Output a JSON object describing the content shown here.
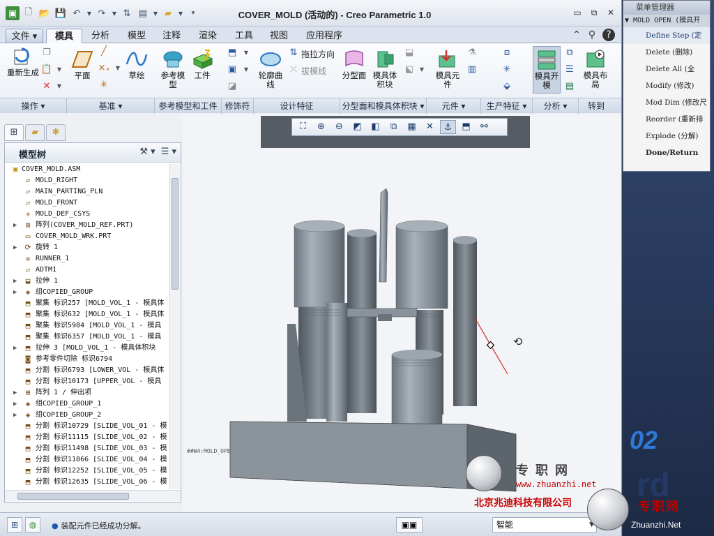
{
  "window": {
    "title": "COVER_MOLD (活动的) - Creo Parametric 1.0"
  },
  "quick_access": {
    "icons": [
      "app-icon",
      "new-icon",
      "open-icon",
      "save-icon",
      "undo-icon",
      "redo-icon",
      "regenerate-icon",
      "window-icon",
      "folder-icon",
      "customize-icon"
    ]
  },
  "tabs": [
    {
      "label": "文件"
    },
    {
      "label": "模具"
    },
    {
      "label": "分析"
    },
    {
      "label": "模型"
    },
    {
      "label": "注释"
    },
    {
      "label": "渲染"
    },
    {
      "label": "工具"
    },
    {
      "label": "视图"
    },
    {
      "label": "应用程序"
    }
  ],
  "ribbon": {
    "regenerate": "重新生成",
    "plane": "平面",
    "sketch": "草绘",
    "ref_model": "参考模型",
    "workpiece": "工件",
    "silhouette": "轮廓曲线",
    "drag_direction": "拖拉方向",
    "draft_line": "拔模线",
    "parting_surface": "分型面",
    "mold_volume": "模具体积块",
    "mold_component": "模具元件",
    "mold_open": "模具开模",
    "mold_layout": "模具布局",
    "groups": [
      "操作",
      "基准",
      "参考模型和工件",
      "修饰符",
      "设计特征",
      "分型面和模具体积块",
      "元件",
      "生产特征",
      "分析",
      "转到"
    ]
  },
  "model_tree": {
    "title": "模型树",
    "items": [
      {
        "label": "COVER_MOLD.ASM",
        "icon": "assembly-icon",
        "expand": ""
      },
      {
        "label": "MOLD_RIGHT",
        "icon": "datum-plane-icon",
        "expand": ""
      },
      {
        "label": "MAIN_PARTING_PLN",
        "icon": "datum-plane-icon",
        "expand": ""
      },
      {
        "label": "MOLD_FRONT",
        "icon": "datum-plane-icon",
        "expand": ""
      },
      {
        "label": "MOLD_DEF_CSYS",
        "icon": "csys-icon",
        "expand": ""
      },
      {
        "label": "阵列(COVER_MOLD_REF.PRT)",
        "icon": "pattern-icon",
        "expand": "▶"
      },
      {
        "label": "COVER_MOLD_WRK.PRT",
        "icon": "workpiece-icon",
        "expand": ""
      },
      {
        "label": "旋转 1",
        "icon": "revolve-icon",
        "expand": "▶"
      },
      {
        "label": "RUNNER_1",
        "icon": "runner-icon",
        "expand": ""
      },
      {
        "label": "ADTM1",
        "icon": "datum-plane-icon",
        "expand": ""
      },
      {
        "label": "拉伸 1",
        "icon": "extrude-icon",
        "expand": "▶"
      },
      {
        "label": "组COPIED_GROUP",
        "icon": "group-icon",
        "expand": "▶"
      },
      {
        "label": "聚集 标识257 [MOLD_VOL_1 - 模具体",
        "icon": "volume-icon",
        "expand": ""
      },
      {
        "label": "聚集 标识632 [MOLD_VOL_1 - 模具体",
        "icon": "volume-icon",
        "expand": ""
      },
      {
        "label": "聚集 标识5984 [MOLD_VOL_1 - 模具",
        "icon": "volume-icon",
        "expand": ""
      },
      {
        "label": "聚集 标识6357 [MOLD_VOL_1 - 模具",
        "icon": "volume-icon",
        "expand": ""
      },
      {
        "label": "拉伸 3 [MOLD_VOL_1 - 模具体积块",
        "icon": "volume-icon",
        "expand": "▶"
      },
      {
        "label": "参考零件切除 标识6794",
        "icon": "cutout-icon",
        "expand": ""
      },
      {
        "label": "分割 标识6793 [LOWER_VOL - 模具体",
        "icon": "volume-icon",
        "expand": ""
      },
      {
        "label": "分割 标识10173 [UPPER_VOL - 模具",
        "icon": "volume-icon",
        "expand": ""
      },
      {
        "label": "阵列 1 / 伸出项",
        "icon": "pattern-icon",
        "expand": "▶"
      },
      {
        "label": "组COPIED_GROUP_1",
        "icon": "group-icon",
        "expand": "▶"
      },
      {
        "label": "组COPIED_GROUP_2",
        "icon": "group-icon",
        "expand": "▶"
      },
      {
        "label": "分割 标识10729 [SLIDE_VOL_01 - 模",
        "icon": "volume-icon",
        "expand": ""
      },
      {
        "label": "分割 标识11115 [SLIDE_VOL_02 - 模",
        "icon": "volume-icon",
        "expand": ""
      },
      {
        "label": "分割 标识11498 [SLIDE_VOL_03 - 模",
        "icon": "volume-icon",
        "expand": ""
      },
      {
        "label": "分割 标识11866 [SLIDE_VOL_04 - 模",
        "icon": "volume-icon",
        "expand": ""
      },
      {
        "label": "分割 标识12252 [SLIDE_VOL_05 - 模",
        "icon": "volume-icon",
        "expand": ""
      },
      {
        "label": "分割 标识12635 [SLIDE_VOL_06 - 模",
        "icon": "volume-icon",
        "expand": ""
      }
    ]
  },
  "graphics": {
    "model_label": "MOLD_OPE"
  },
  "status": {
    "message": "装配元件已经成功分解。",
    "smart_filter": "智能"
  },
  "menu_manager": {
    "title": "菜单管理器",
    "subtitle": "▼ MOLD OPEN (模具开",
    "items": [
      {
        "label": "Define Step (定"
      },
      {
        "label": "Delete (删除)"
      },
      {
        "label": "Delete All (全"
      },
      {
        "label": "Modify (修改)"
      },
      {
        "label": "Mod Dim (修改尺"
      },
      {
        "label": "Reorder (重新排"
      },
      {
        "label": "Explode (分解)"
      },
      {
        "label": "Done/Return"
      }
    ]
  },
  "side_text": {
    "big": "02",
    "big2": "rd"
  },
  "watermarks": {
    "brand": "专职网",
    "url": "www.zhuanzhi.net",
    "company": "北京兆迪科技有限公司",
    "brand2": "专职网",
    "domain": "Zhuanzhi.Net"
  }
}
